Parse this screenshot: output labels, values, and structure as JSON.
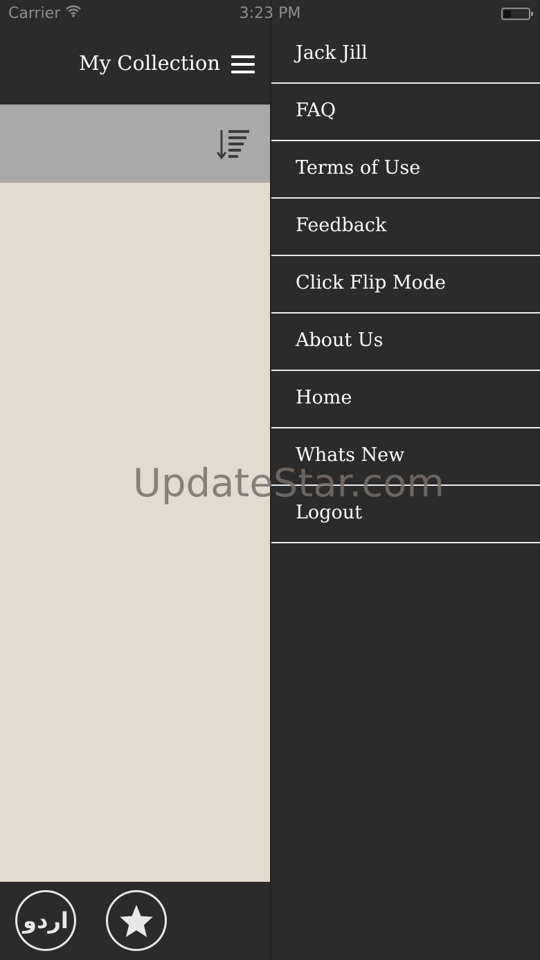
{
  "status_bar": {
    "carrier": "Carrier",
    "time": "3:23 PM"
  },
  "header": {
    "title": "My Collection"
  },
  "bottom_bar": {
    "urdu_label": "اردو"
  },
  "menu": {
    "items": [
      {
        "label": "Jack Jill"
      },
      {
        "label": "FAQ"
      },
      {
        "label": "Terms of Use"
      },
      {
        "label": "Feedback"
      },
      {
        "label": "Click Flip Mode"
      },
      {
        "label": "About Us"
      },
      {
        "label": "Home"
      },
      {
        "label": "Whats New"
      },
      {
        "label": "Logout"
      }
    ]
  },
  "watermark": "UpdateStar.com",
  "colors": {
    "dark_background": "#2b2b2c",
    "sort_bar": "#a9a9a9",
    "content_background": "#e5dace",
    "text_light": "#ffffff"
  }
}
